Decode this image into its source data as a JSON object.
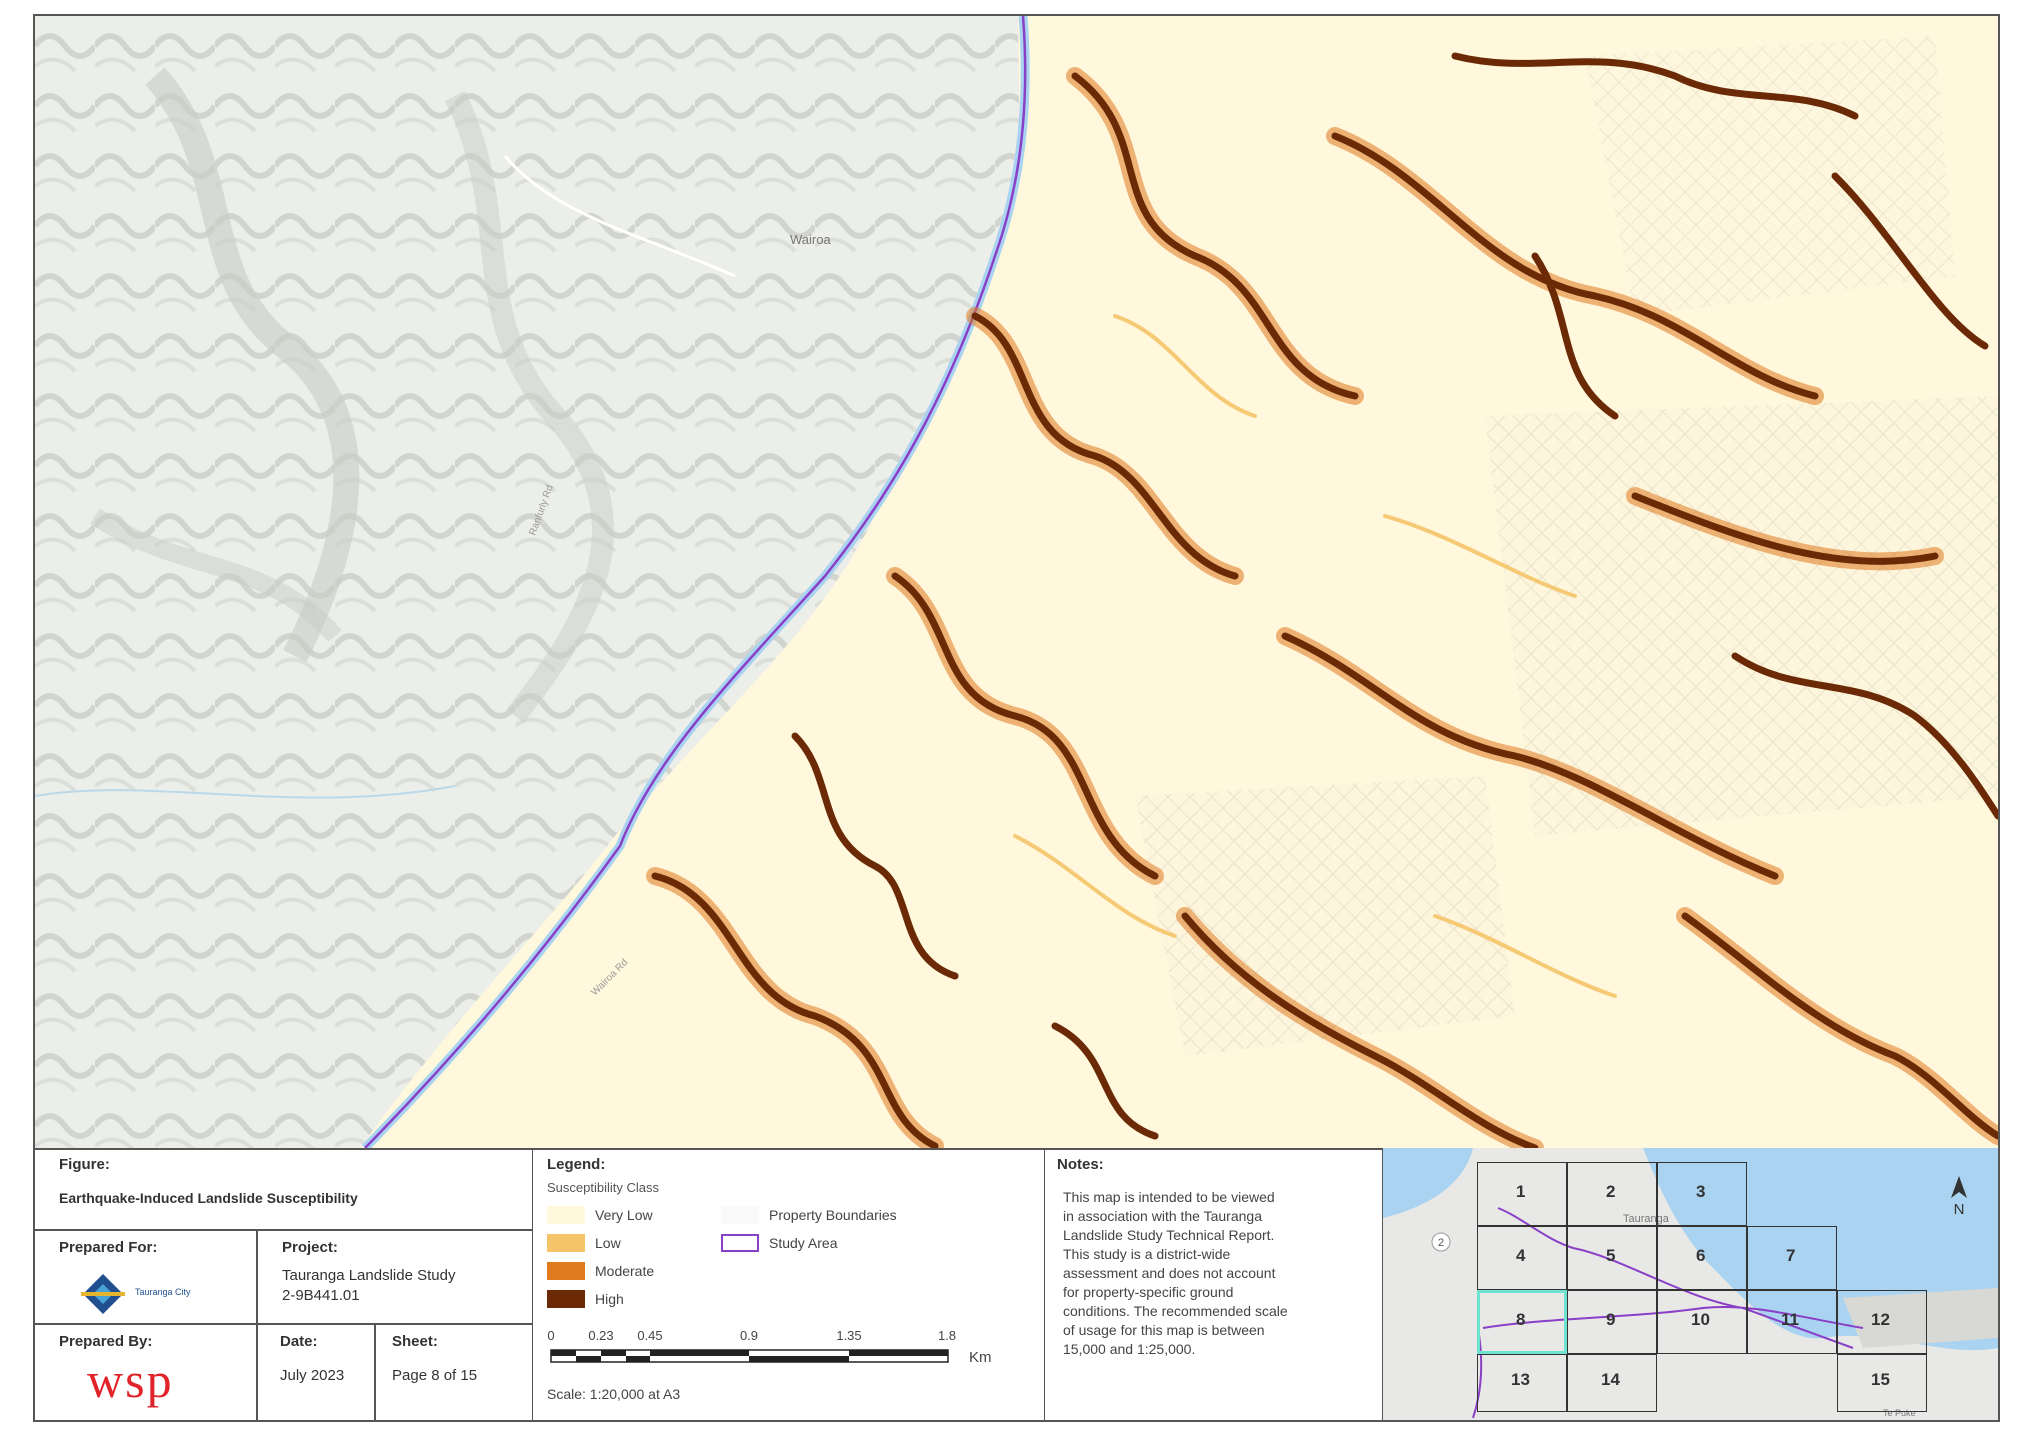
{
  "map": {
    "place_label": "Wairoa",
    "road_label_1": "Ranfurly Rd",
    "road_label_2": "Wairoa Rd",
    "colors": {
      "very_low": "#fff8dc",
      "low": "#f5c469",
      "moderate": "#e07a1f",
      "high": "#6b2a05",
      "study_area": "#8a3fc7",
      "water": "#a9d3f0",
      "basemap": "#eef0ec"
    }
  },
  "titleblock": {
    "figure_label": "Figure:",
    "figure_title": "Earthquake-Induced Landslide Susceptibility",
    "prepared_for_label": "Prepared For:",
    "prepared_for_org": "Tauranga City",
    "project_label": "Project:",
    "project_name": "Tauranga Landslide Study",
    "project_number": "2-9B441.01",
    "prepared_by_label": "Prepared By:",
    "prepared_by_logo": "wsp",
    "date_label": "Date:",
    "date_value": "July 2023",
    "sheet_label": "Sheet:",
    "sheet_value": "Page 8 of 15"
  },
  "legend": {
    "title": "Legend:",
    "subtitle": "Susceptibility Class",
    "items": [
      {
        "label": "Very Low",
        "color": "#fff8dc"
      },
      {
        "label": "Low",
        "color": "#f5c469"
      },
      {
        "label": "Moderate",
        "color": "#e07a1f"
      },
      {
        "label": "High",
        "color": "#6b2a05"
      }
    ],
    "property_boundaries": "Property Boundaries",
    "study_area": "Study Area",
    "scale_ticks": [
      "0",
      "0.23",
      "0.45",
      "0.9",
      "1.35",
      "1.8"
    ],
    "scale_unit": "Km",
    "scale_text": "Scale: 1:20,000 at A3"
  },
  "notes": {
    "title": "Notes:",
    "lines": [
      "This map is intended to be viewed",
      "in association with the Tauranga",
      "Landslide Study Technical Report.",
      "This study is a district-wide",
      "assessment and does not account",
      "for property-specific ground",
      "conditions. The recommended scale",
      "of usage for this map is between",
      "15,000 and 1:25,000."
    ]
  },
  "inset": {
    "north": "N",
    "highway": "2",
    "place_1": "Tauranga",
    "place_2": "Te Puke",
    "sheets": [
      "1",
      "2",
      "3",
      "4",
      "5",
      "6",
      "7",
      "8",
      "9",
      "10",
      "11",
      "12",
      "13",
      "14",
      "15"
    ],
    "current_sheet": "8"
  }
}
